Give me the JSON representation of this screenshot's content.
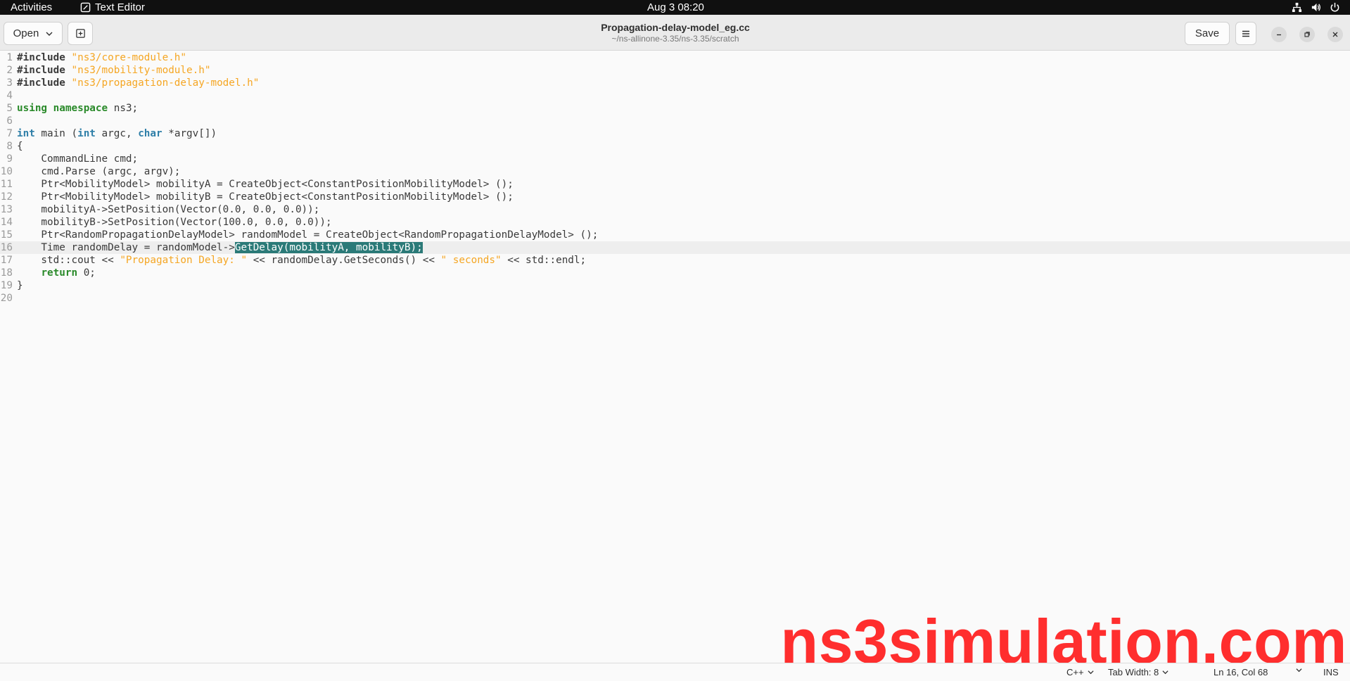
{
  "topbar": {
    "activities": "Activities",
    "app_name": "Text Editor",
    "clock": "Aug 3  08:20"
  },
  "header": {
    "open_label": "Open",
    "save_label": "Save",
    "title": "Propagation-delay-model_eg.cc",
    "path": "~/ns-allinone-3.35/ns-3.35/scratch"
  },
  "editor": {
    "lines": [
      {
        "n": "1",
        "code": "#include \"ns3/core-module.h\""
      },
      {
        "n": "2",
        "code": "#include \"ns3/mobility-module.h\""
      },
      {
        "n": "3",
        "code": "#include \"ns3/propagation-delay-model.h\""
      },
      {
        "n": "4",
        "code": ""
      },
      {
        "n": "5",
        "code": "using namespace ns3;"
      },
      {
        "n": "6",
        "code": ""
      },
      {
        "n": "7",
        "code": "int main (int argc, char *argv[])"
      },
      {
        "n": "8",
        "code": "{"
      },
      {
        "n": "9",
        "code": "    CommandLine cmd;"
      },
      {
        "n": "10",
        "code": "    cmd.Parse (argc, argv);"
      },
      {
        "n": "11",
        "code": "    Ptr<MobilityModel> mobilityA = CreateObject<ConstantPositionMobilityModel> ();"
      },
      {
        "n": "12",
        "code": "    Ptr<MobilityModel> mobilityB = CreateObject<ConstantPositionMobilityModel> ();"
      },
      {
        "n": "13",
        "code": "    mobilityA->SetPosition(Vector(0.0, 0.0, 0.0));"
      },
      {
        "n": "14",
        "code": "    mobilityB->SetPosition(Vector(100.0, 0.0, 0.0));"
      },
      {
        "n": "15",
        "code": "    Ptr<RandomPropagationDelayModel> randomModel = CreateObject<RandomPropagationDelayModel> ();"
      },
      {
        "n": "16",
        "code": "    Time randomDelay = randomModel->GetDelay(mobilityA, mobilityB);"
      },
      {
        "n": "17",
        "code": "    std::cout << \"Propagation Delay: \" << randomDelay.GetSeconds() << \" seconds\" << std::endl;"
      },
      {
        "n": "18",
        "code": "    return 0;"
      },
      {
        "n": "19",
        "code": "}"
      },
      {
        "n": "20",
        "code": ""
      }
    ],
    "current_line": "16",
    "selected_text": "GetDelay(mobilityA, mobilityB);"
  },
  "watermark": "ns3simulation.com",
  "statusbar": {
    "language": "C++",
    "tab_width": "Tab Width: 8",
    "position": "Ln 16, Col 68",
    "mode": "INS"
  },
  "colors": {
    "keyword": "#2a8a2a",
    "type": "#2f7fa8",
    "string": "#f5a623",
    "selection": "#2b7a78",
    "watermark": "#ff2e2e"
  }
}
